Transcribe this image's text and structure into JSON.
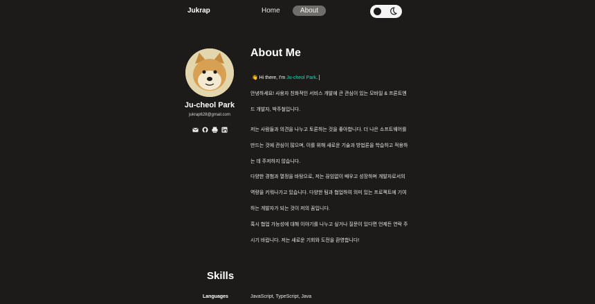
{
  "nav": {
    "brand": "Jukrap",
    "home_label": "Home",
    "about_label": "About",
    "theme_toggle": {
      "icon": "moon-icon",
      "state": "dark"
    }
  },
  "profile": {
    "name": "Ju-cheol Park",
    "email": "jukrap628@gmail.com",
    "avatar_icon": "doge-avatar",
    "socials": [
      {
        "icon": "mail-icon"
      },
      {
        "icon": "github-icon"
      },
      {
        "icon": "blog-icon"
      },
      {
        "icon": "linkedin-icon"
      }
    ]
  },
  "about": {
    "title": "About Me",
    "greeting_wave": "👋",
    "greeting_prefix": "Hi there, I'm ",
    "greeting_name": "Ju-cheol Park",
    "greeting_suffix": ".",
    "paragraphs": [
      "안녕하세요! 사용자 친화적인 서비스 개발에 큰 관심이 있는 모바일 & 프론트엔드 개발자, 박주철입니다.",
      "저는 사람들과 의견을 나누고 토론하는 것을 좋아합니다. 더 나은 소프트웨어를 만드는 것에 관심이 많으며, 이를 위해 새로운 기술과 방법론을 학습하고 적용하는 데 주저하지 않습니다.",
      "다양한 경험과 열정을 바탕으로, 저는 끊임없이 배우고 성장하며 개발자로서의 역량을 키워나가고 있습니다. 다양한 팀과 협업하여 의미 있는 프로젝트에 기여하는 개발자가 되는 것이 저의 꿈입니다.",
      "혹시 협업 가능성에 대해 이야기를 나누고 싶거나 질문이 있다면 언제든 연락 주시기 바랍니다. 저는 새로운 기회와 도전을 환영합니다!"
    ]
  },
  "skills": {
    "title": "Skills",
    "rows": [
      {
        "label": "Languages",
        "value": "JavaScript, TypeScript, Java"
      }
    ]
  },
  "colors": {
    "background": "#1c1b19",
    "accent": "#2fd3b0",
    "nav_active": "#6f6e6a"
  }
}
